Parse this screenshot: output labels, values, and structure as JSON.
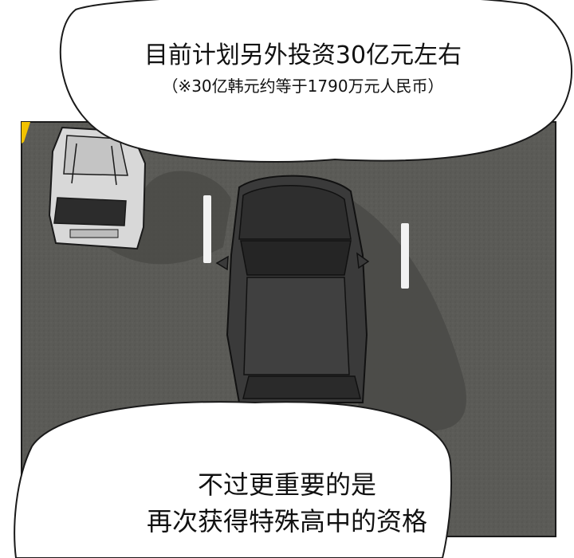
{
  "panel": {
    "top_bubble": {
      "line1": "目前计划另外投资30亿元左右",
      "line2": "（※30亿韩元约等于1790万元人民币）"
    },
    "bottom_bubble": {
      "line1": "不过更重要的是",
      "line2": "再次获得特殊高中的资格"
    }
  },
  "colors": {
    "road": "#5b5b57",
    "lane_marking": "#f2f2f2",
    "curb_yellow": "#f2c200",
    "black_car": "#3a3a3a",
    "white_car": "#d8d8d8",
    "bubble_fill": "#ffffff",
    "bubble_stroke": "#1a1a1a"
  }
}
